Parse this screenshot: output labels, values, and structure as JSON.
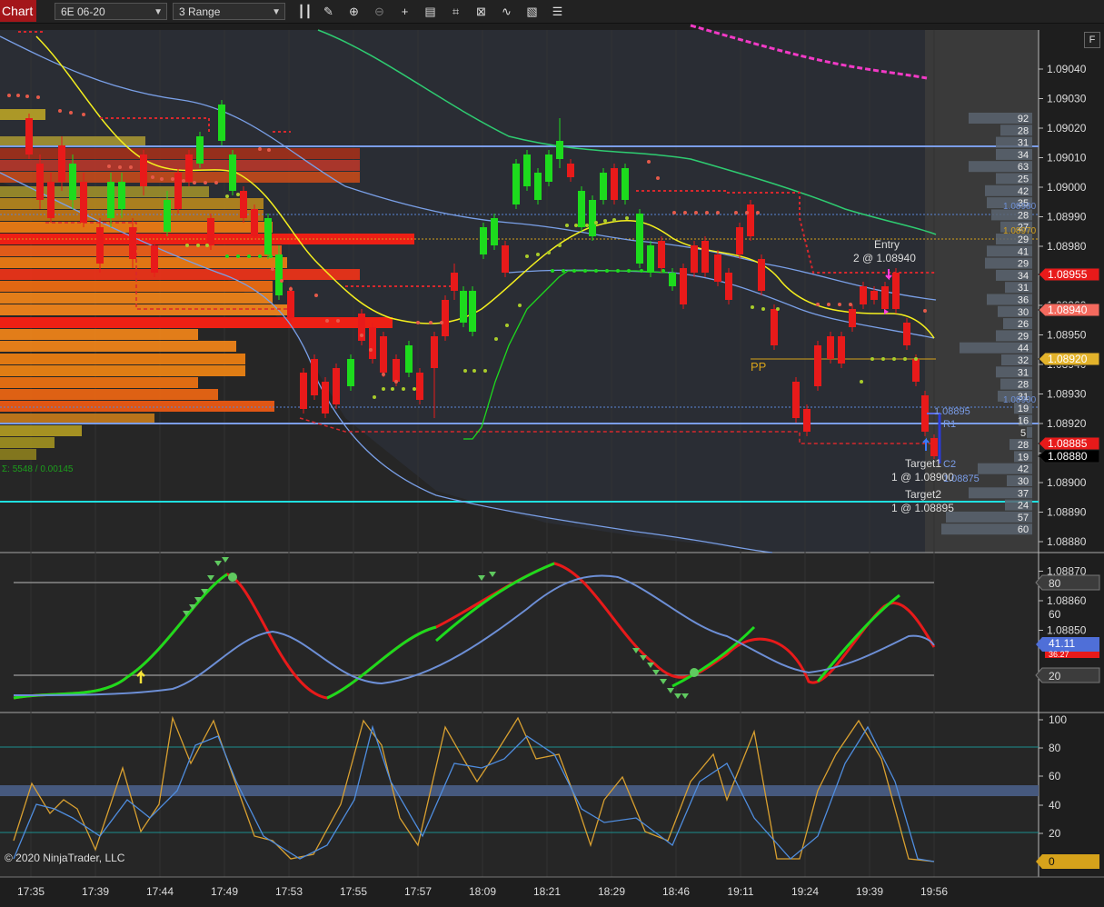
{
  "toolbar": {
    "tab_label": "Chart",
    "instrument": "6E 06-20",
    "bar_type": "3 Range",
    "icons": [
      "bar-style-icon",
      "draw-pencil-icon",
      "zoom-in-icon",
      "zoom-out-icon",
      "crosshair-icon",
      "properties-icon",
      "indicators-icon",
      "strategies-icon",
      "templates-icon",
      "data-box-icon"
    ]
  },
  "fullscreen_label": "F",
  "price_axis": {
    "ticks": [
      "1.09040",
      "1.09030",
      "1.09020",
      "1.09010",
      "1.09000",
      "1.08990",
      "1.08980",
      "1.08970",
      "1.08960",
      "1.08950",
      "1.08940",
      "1.08930",
      "1.08920",
      "1.08910",
      "1.08900",
      "1.08890",
      "1.08880",
      "1.08870",
      "1.08860",
      "1.08850"
    ],
    "markers": [
      {
        "label": "1.08955",
        "color": "#e81a1a"
      },
      {
        "label": "1.08940",
        "color": "#f46a5e"
      },
      {
        "label": "1.08920",
        "color": "#e3b32b"
      },
      {
        "label": "1.08885",
        "color": "#e81a1a"
      },
      {
        "label": "1.08880",
        "color": "#000000"
      }
    ],
    "tags": [
      "1.08980",
      "1.08970",
      "1.08900"
    ]
  },
  "volume_ladder": [
    "92",
    "28",
    "31",
    "34",
    "63",
    "25",
    "42",
    "35",
    "28",
    "27",
    "29",
    "41",
    "29",
    "34",
    "31",
    "36",
    "30",
    "26",
    "29",
    "44",
    "32",
    "31",
    "28",
    "31",
    "19",
    "16",
    "5",
    "28",
    "19",
    "42",
    "30",
    "37",
    "24",
    "57",
    "60"
  ],
  "orders": {
    "entry_label": "Entry",
    "entry_detail": "2 @ 1.08940",
    "target1_label": "Target1",
    "target1_detail": "1 @ 1.08900",
    "target2_label": "Target2",
    "target2_detail": "1 @ 1.08895",
    "stop_price": "1.08895",
    "r1_label": "R1",
    "c2_label": "C2",
    "pp_label": "PP",
    "stop2_price": "1.08875"
  },
  "vp_summary": "Σ: 5548 / 0.00145",
  "osc1_axis": {
    "ticks": [
      "80",
      "60",
      "20"
    ],
    "value_a": "41.11",
    "value_b": "36.27"
  },
  "osc2_axis": {
    "ticks": [
      "100",
      "80",
      "60",
      "40",
      "20"
    ],
    "value": "0"
  },
  "time_axis": [
    "17:35",
    "17:39",
    "17:44",
    "17:49",
    "17:53",
    "17:55",
    "17:57",
    "18:09",
    "18:21",
    "18:29",
    "18:46",
    "19:11",
    "19:24",
    "19:39",
    "19:56"
  ],
  "copyright": "© 2020 NinjaTrader, LLC",
  "colors": {
    "up": "#1ddb1d",
    "down": "#e81a1a",
    "ema": "#f5f01e",
    "band": "#6d8fd6",
    "slow_ma": "#2ecc71",
    "vp_orange": "#f07d12",
    "vp_olive": "#b7a226"
  }
}
